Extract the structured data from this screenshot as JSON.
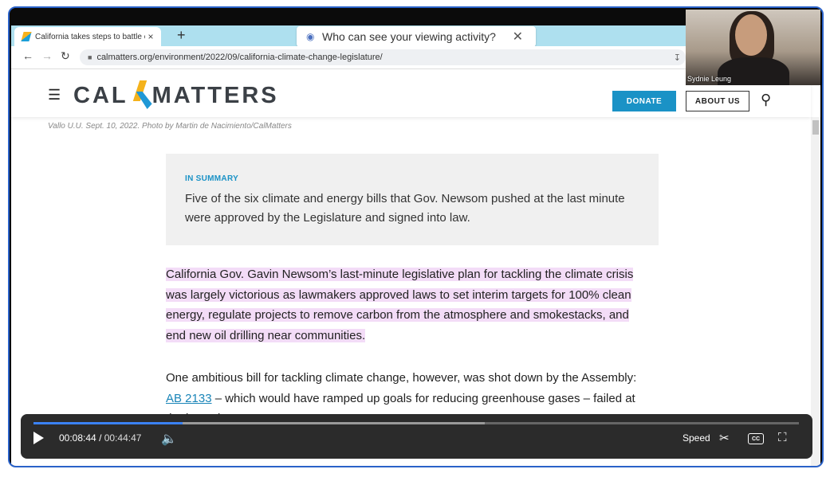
{
  "browser": {
    "tab_title": "California takes steps to battle cli",
    "tab_close": "×",
    "new_tab": "+",
    "url": "calmatters.org/environment/2022/09/california-climate-change-legislature/"
  },
  "popup": {
    "title": "Who can see your viewing activity?",
    "close": "✕"
  },
  "site": {
    "logo_left": "CAL",
    "logo_right": "MATTERS",
    "donate": "DONATE",
    "about": "ABOUT US"
  },
  "article": {
    "caption": "Vallo U.U. Sept. 10, 2022. Photo by Martin de Nacimiento/CalMatters",
    "summary_label": "IN SUMMARY",
    "summary_text": "Five of the six climate and energy bills that Gov. Newsom pushed at the last minute were approved by the Legislature and signed into law.",
    "para1": "California Gov. Gavin Newsom’s last-minute legislative plan for tackling the climate crisis was largely victorious as lawmakers approved laws to set interim targets for 100% clean energy, regulate projects to remove carbon from the atmosphere and smokestacks, and end new oil drilling near communities.",
    "para2_before": "One ambitious bill for tackling climate change, however, was shot down by the Assembly: ",
    "para2_link": "AB 2133",
    "para2_after": " – which would have ramped up goals for reducing greenhouse gases – failed at the last minute."
  },
  "player": {
    "current_time": "00:08:44",
    "separator": "/",
    "duration": "00:44:47",
    "speed_label": "Speed",
    "cc_label": "CC",
    "progress_fraction": 0.195,
    "buffered_fraction": 0.59
  },
  "webcam": {
    "participant_name": "Sydnie Leung"
  }
}
